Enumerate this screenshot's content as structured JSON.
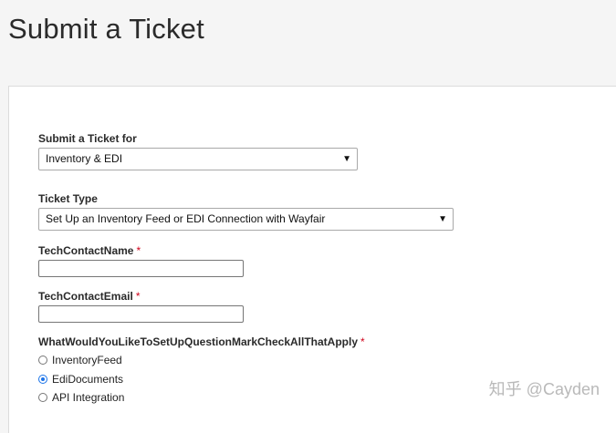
{
  "page": {
    "title": "Submit a Ticket"
  },
  "form": {
    "submit_for": {
      "label": "Submit a Ticket for",
      "value": "Inventory & EDI"
    },
    "ticket_type": {
      "label": "Ticket Type",
      "value": "Set Up an Inventory Feed or EDI Connection with Wayfair"
    },
    "tech_contact_name": {
      "label": "TechContactName",
      "required_mark": "*",
      "value": ""
    },
    "tech_contact_email": {
      "label": "TechContactEmail",
      "required_mark": "*",
      "value": ""
    },
    "setup_question": {
      "label": "WhatWouldYouLikeToSetUpQuestionMarkCheckAllThatApply",
      "required_mark": "*",
      "options": [
        {
          "label": "InventoryFeed",
          "selected": false
        },
        {
          "label": "EdiDocuments",
          "selected": true
        },
        {
          "label": "API Integration",
          "selected": false
        }
      ]
    }
  },
  "watermark": {
    "text": "知乎 @Cayden"
  },
  "colors": {
    "required": "#d0021b",
    "radio_selected": "#1a73e8"
  }
}
